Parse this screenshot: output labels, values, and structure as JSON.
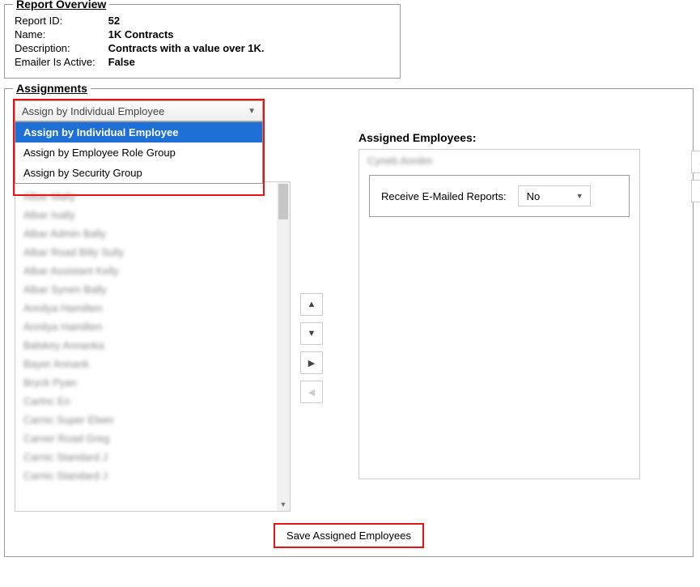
{
  "overview": {
    "legend": "Report Overview",
    "fields": [
      {
        "label": "Report ID:",
        "value": "52"
      },
      {
        "label": "Name:",
        "value": "1K Contracts"
      },
      {
        "label": "Description:",
        "value": "Contracts with a value over 1K."
      },
      {
        "label": "Emailer Is Active:",
        "value": "False"
      }
    ]
  },
  "assignments": {
    "legend": "Assignments",
    "dropdown": {
      "selected": "Assign by Individual Employee",
      "options": [
        "Assign by Individual Employee",
        "Assign by Employee Role Group",
        "Assign by Security Group"
      ]
    },
    "available": {
      "items": [
        "Albar Mally",
        "Albar Isally",
        "Albar Admin Bally",
        "Albar Road Billy Sully",
        "Albar Assistant Kelly",
        "Albar Synen Bally",
        "Annilya Hamilten",
        "Annilya Hamilten",
        "Balskey Annanka",
        "Bayer Annank",
        "Bryck Pyan",
        "Cartnc En",
        "Carnic Super Elwer",
        "Carver Road Greg",
        "Carnic Standard J",
        "Carnic Standard J"
      ]
    },
    "assigned": {
      "label": "Assigned Employees:",
      "item": "Cyneb Annilm",
      "email_label": "Receive E-Mailed Reports:",
      "email_value": "No"
    },
    "save_label": "Save Assigned Employees"
  }
}
